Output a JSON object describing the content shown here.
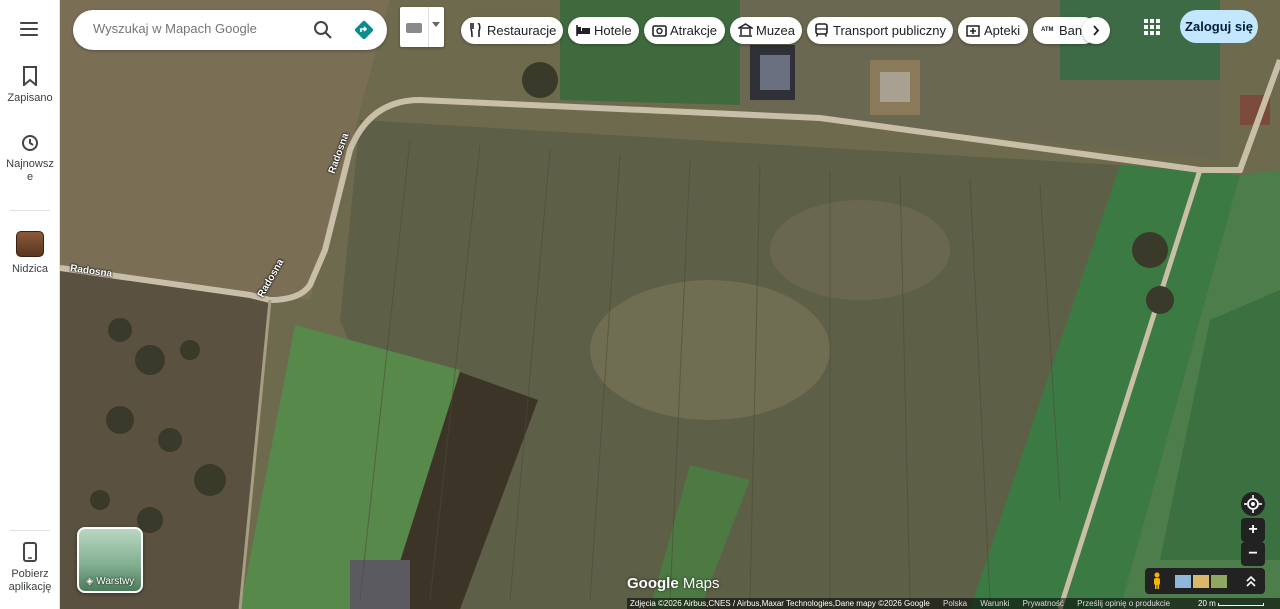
{
  "rail": {
    "saved_label": "Zapisano",
    "recent_label": "Najnowsze",
    "place_label": "Nidzica",
    "download_label": "Pobierz aplikację"
  },
  "search": {
    "placeholder": "Wyszukaj w Mapach Google"
  },
  "chips": [
    {
      "label": "Restauracje",
      "icon": "fork-knife-icon"
    },
    {
      "label": "Hotele",
      "icon": "bed-icon"
    },
    {
      "label": "Atrakcje",
      "icon": "camera-icon"
    },
    {
      "label": "Muzea",
      "icon": "museum-icon"
    },
    {
      "label": "Transport publiczny",
      "icon": "train-icon"
    },
    {
      "label": "Apteki",
      "icon": "pharmacy-icon"
    },
    {
      "label": "Bank",
      "icon": "atm-icon"
    }
  ],
  "header": {
    "login_label": "Zaloguj się"
  },
  "layers": {
    "label": "Warstwy"
  },
  "map": {
    "road_labels": [
      "Radosna",
      "Radosna",
      "Radosna"
    ]
  },
  "logo": {
    "google": "Google",
    "maps": "Maps"
  },
  "attribution": {
    "imagery": "Zdjęcia ©2026 Airbus,CNES / Airbus,Maxar Technologies,Dane mapy ©2026 Google",
    "country": "Polska",
    "terms": "Warunki",
    "privacy": "Prywatność",
    "feedback": "Prześlij opinię o produkcie",
    "scale": "20 m"
  },
  "colors": {
    "accent": "#c2e7ff",
    "direction_teal": "#0b8d8d"
  }
}
